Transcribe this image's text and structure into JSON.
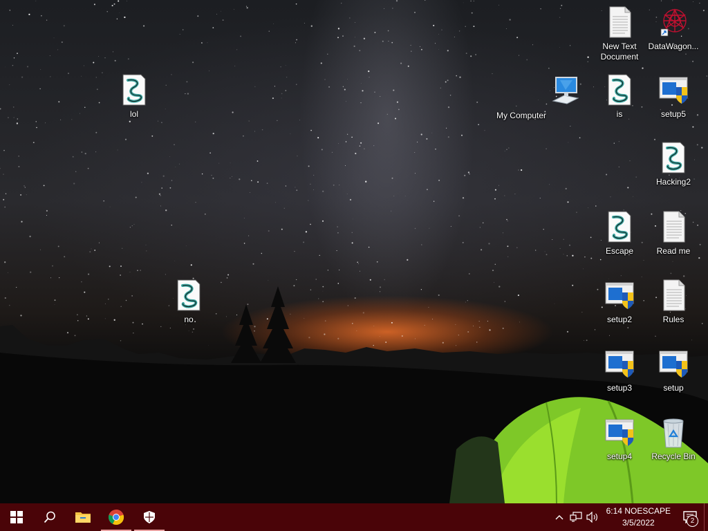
{
  "desktop": {
    "icons": [
      {
        "label": "New Text Document",
        "icon": "text-file-icon"
      },
      {
        "label": "DataWagon...",
        "icon": "shortcut-app-icon"
      },
      {
        "label": "lol",
        "icon": "script-file-icon"
      },
      {
        "label": "My Computer",
        "icon": "computer-icon"
      },
      {
        "label": "is",
        "icon": "script-file-icon"
      },
      {
        "label": "setup5",
        "icon": "installer-icon"
      },
      {
        "label": "Hacking2",
        "icon": "script-file-icon"
      },
      {
        "label": "Escape",
        "icon": "script-file-icon"
      },
      {
        "label": "Read me",
        "icon": "text-file-icon"
      },
      {
        "label": "no",
        "icon": "script-file-icon"
      },
      {
        "label": "setup2",
        "icon": "installer-icon"
      },
      {
        "label": "Rules",
        "icon": "text-file-icon"
      },
      {
        "label": "setup3",
        "icon": "installer-icon"
      },
      {
        "label": "setup",
        "icon": "installer-icon"
      },
      {
        "label": "setup4",
        "icon": "installer-icon"
      },
      {
        "label": "Recycle Bin",
        "icon": "recycle-bin-icon"
      }
    ]
  },
  "taskbar": {
    "color": "#4a0408",
    "buttons": [
      {
        "icon": "windows-start-icon"
      },
      {
        "icon": "search-icon"
      },
      {
        "icon": "file-explorer-icon"
      },
      {
        "icon": "chrome-icon"
      },
      {
        "icon": "security-shield-icon"
      }
    ],
    "tray": {
      "icons": [
        "chevron-up-icon",
        "network-icon",
        "volume-icon"
      ],
      "clock_time": "6:14 NOESCAPE",
      "clock_date": "3/5/2022",
      "notification_count": "2"
    }
  }
}
